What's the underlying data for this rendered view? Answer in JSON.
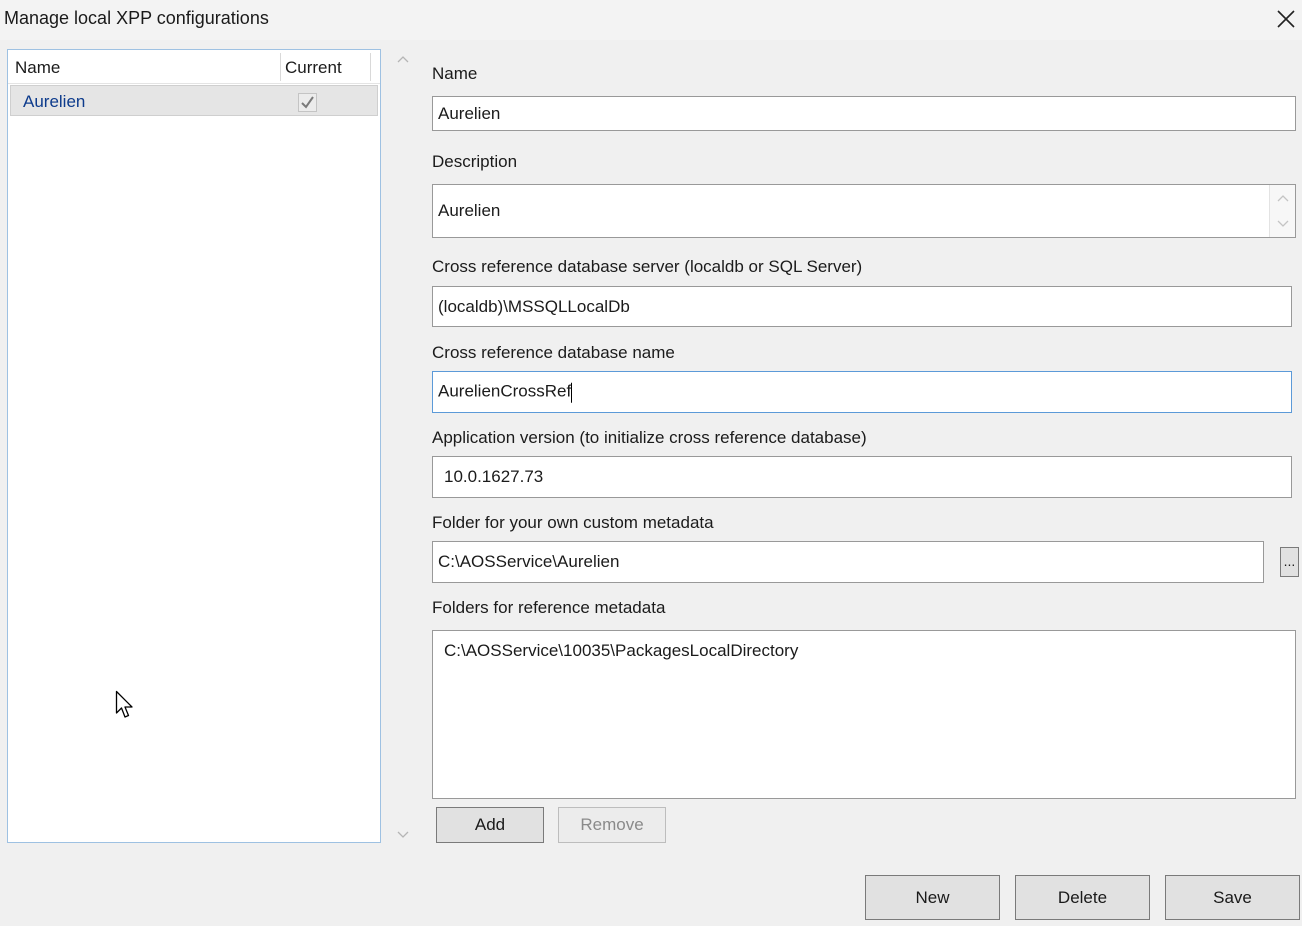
{
  "window": {
    "title": "Manage local XPP configurations"
  },
  "list": {
    "columns": {
      "name": "Name",
      "current": "Current"
    },
    "rows": [
      {
        "name": "Aurelien",
        "current": true
      }
    ]
  },
  "form": {
    "name_label": "Name",
    "name_value": "Aurelien",
    "description_label": "Description",
    "description_value": "Aurelien",
    "xref_server_label": "Cross reference database server (localdb or SQL Server)",
    "xref_server_value": "(localdb)\\MSSQLLocalDb",
    "xref_db_label": "Cross reference database name",
    "xref_db_value": "AurelienCrossRef",
    "app_version_label": "Application version (to initialize cross reference database)",
    "app_version_value": "10.0.1627.73",
    "custom_folder_label": "Folder for your own custom metadata",
    "custom_folder_value": "C:\\AOSService\\Aurelien",
    "browse_label": "...",
    "ref_folders_label": "Folders for reference metadata",
    "ref_folders": [
      "C:\\AOSService\\10035\\PackagesLocalDirectory"
    ],
    "add_label": "Add",
    "remove_label": "Remove"
  },
  "footer": {
    "new_label": "New",
    "delete_label": "Delete",
    "save_label": "Save"
  },
  "icons": {
    "close": "close-icon",
    "check": "checkmark-icon",
    "scroll_up": "chevron-up-icon",
    "scroll_down": "chevron-down-icon",
    "cursor": "mouse-pointer-icon"
  }
}
